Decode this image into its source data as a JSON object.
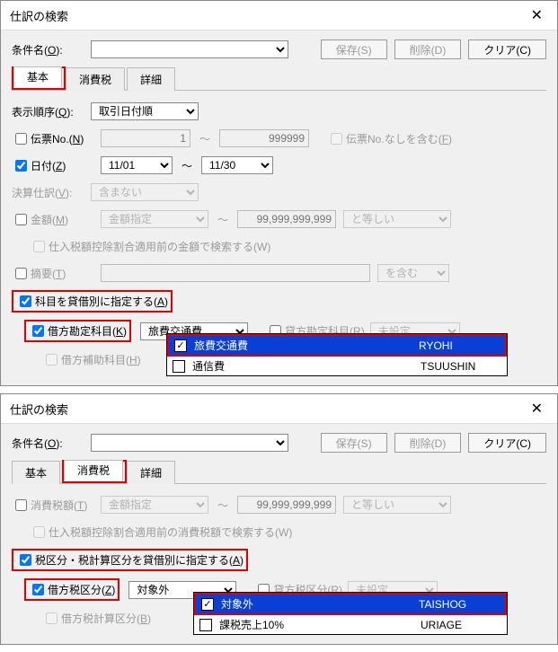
{
  "win1": {
    "title": "仕訳の検索",
    "condName": {
      "label": "条件名(",
      "key": "O",
      "tail": "):"
    },
    "btns": {
      "save": "保存(S)",
      "del": "削除(D)",
      "clear": "クリア(C)"
    },
    "tabs": {
      "basic": "基本",
      "tax": "消費税",
      "detail": "詳細"
    },
    "order": {
      "label": "表示順序(",
      "key": "Q",
      "tail": "):",
      "value": "取引日付順"
    },
    "slipNo": {
      "label": "伝票No.(",
      "key": "N",
      "tail": ")",
      "ph1": "1",
      "ph2": "999999",
      "opt": "伝票No.なしを含む(",
      "optKey": "F",
      "optTail": ")"
    },
    "date": {
      "label": "日付(",
      "key": "Z",
      "tail": ")",
      "from": "11/01",
      "to": "11/30"
    },
    "closing": {
      "label": "決算仕訳(",
      "key": "V",
      "tail": "):",
      "value": "含まない"
    },
    "amount": {
      "label": "金額(",
      "key": "M",
      "tail": ")",
      "spec": "金額指定",
      "ph": "99,999,999,999",
      "cond": "と等しい"
    },
    "amountSub": "仕入税額控除割合適用前の金額で検索する(W)",
    "summary": {
      "label": "摘要(",
      "key": "T",
      "tail": ")",
      "cond": "を含む"
    },
    "byAcct": {
      "label": "科目を貸借別に指定する(",
      "key": "A",
      "tail": ")"
    },
    "drAcct": {
      "label": "借方勘定科目(",
      "key": "K",
      "tail": ")",
      "value": "旅費交通費"
    },
    "crAcct": {
      "label": "貸方勘定科目(",
      "key": "R",
      "tail": ")",
      "value": "未設定"
    },
    "drSub": {
      "label": "借方補助科目(",
      "key": "H",
      "tail": ")"
    },
    "list": {
      "r1": {
        "name": "旅費交通費",
        "code": "RYOHI"
      },
      "r2": {
        "name": "通信費",
        "code": "TSUUSHIN"
      }
    }
  },
  "win2": {
    "title": "仕訳の検索",
    "condName": {
      "label": "条件名(",
      "key": "O",
      "tail": "):"
    },
    "btns": {
      "save": "保存(S)",
      "del": "削除(D)",
      "clear": "クリア(C)"
    },
    "tabs": {
      "basic": "基本",
      "tax": "消費税",
      "detail": "詳細"
    },
    "taxAmt": {
      "label": "消費税額(",
      "key": "T",
      "tail": ")",
      "spec": "金額指定",
      "ph": "99,999,999,999",
      "cond": "と等しい"
    },
    "taxSub": "仕入税額控除割合適用前の消費税額で検索する(W)",
    "byTax": {
      "label": "税区分・税計算区分を貸借別に指定する(",
      "key": "A",
      "tail": ")"
    },
    "drTax": {
      "label": "借方税区分(",
      "key": "Z",
      "tail": ")",
      "value": "対象外"
    },
    "crTax": {
      "label": "貸方税区分(",
      "key": "R",
      "tail": ")",
      "value": "未設定"
    },
    "drCalc": {
      "label": "借方税計算区分(",
      "key": "B",
      "tail": ")"
    },
    "list": {
      "r1": {
        "name": "対象外",
        "code": "TAISHOG"
      },
      "r2": {
        "name": "課税売上10%",
        "code": "URIAGE"
      }
    }
  }
}
